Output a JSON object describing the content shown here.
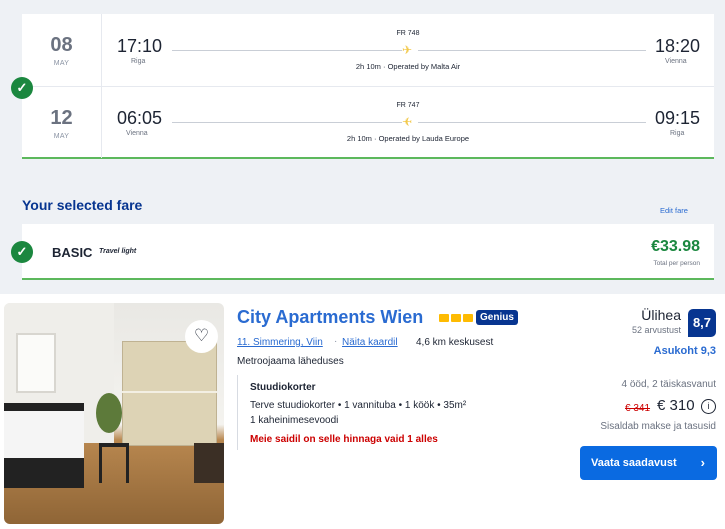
{
  "flights": [
    {
      "day": "08",
      "month": "MAY",
      "dep_time": "17:10",
      "dep_city": "Riga",
      "flight_no": "FR 748",
      "duration": "2h 10m · Operated by Malta Air",
      "arr_time": "18:20",
      "arr_city": "Vienna",
      "plane_glyph": "✈"
    },
    {
      "day": "12",
      "month": "MAY",
      "dep_time": "06:05",
      "dep_city": "Vienna",
      "flight_no": "FR 747",
      "duration": "2h 10m · Operated by Lauda Europe",
      "arr_time": "09:15",
      "arr_city": "Riga",
      "plane_glyph": "✈"
    }
  ],
  "fare": {
    "heading": "Your selected fare",
    "edit_label": "Edit fare",
    "name": "BASIC",
    "subtitle": "Travel light",
    "price": "€33.98",
    "per_person": "Total per person"
  },
  "hotel": {
    "name": "City Apartments Wien",
    "genius": "Genius",
    "district": "11. Simmering, Viin",
    "map_link": "Näita kaardil",
    "distance": "4,6 km keskusest",
    "metro": "Metroojaama läheduses",
    "room_title": "Stuudiokorter",
    "room_desc": "Terve stuudiokorter • 1 vannituba • 1 köök • 35m²",
    "room_beds": "1 kaheinimesevoodi",
    "alert": "Meie saidil on selle hinnaga vaid 1 alles",
    "review_label": "Ülihea",
    "review_count": "52 arvustust",
    "score": "8,7",
    "location_score": "Asukoht 9,3",
    "guests": "4 ööd, 2 täiskasvanut",
    "old_price": "€ 341",
    "price": "€ 310",
    "tax_note": "Sisaldab makse ja tasusid",
    "button_label": "Vaata saadavust",
    "stars": 3
  },
  "colors": {
    "accent": "#073590",
    "link": "#2a6bd1",
    "success": "#1b873f",
    "alert": "#cc0000",
    "button": "#0a6ae1",
    "star": "#febb02",
    "plane": "#f2c94c"
  }
}
